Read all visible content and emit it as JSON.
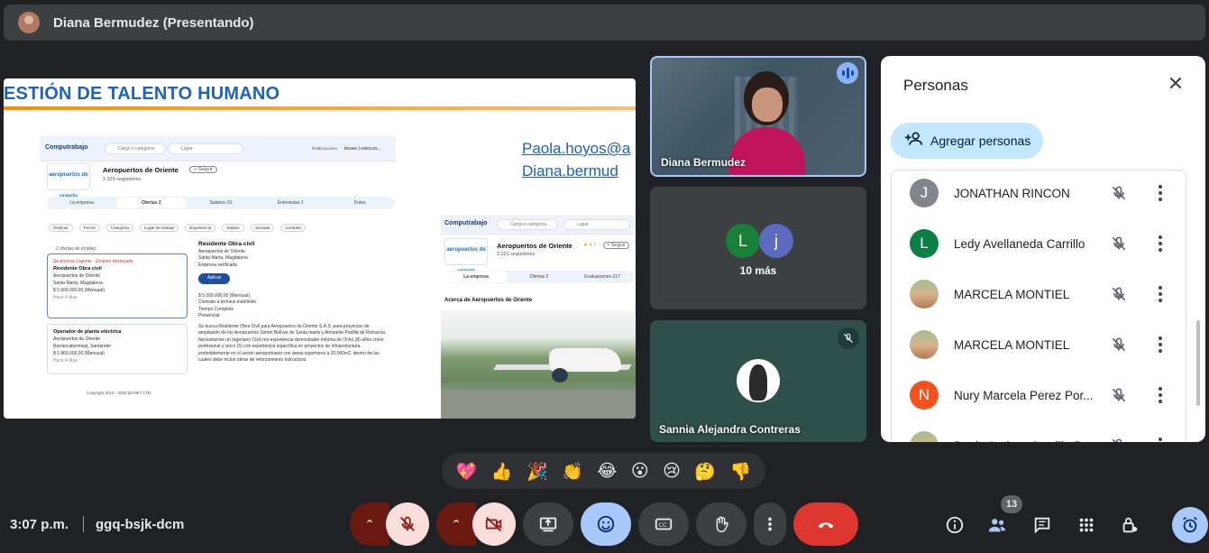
{
  "topbar": {
    "presenter": "Diana Bermudez (Presentando)"
  },
  "slide": {
    "heading": "ESTIÓN DE TALENTO HUMANO",
    "emails": [
      "Paola.hoyos@a",
      "Diana.bermud"
    ],
    "portal_logo": "Computrabajo",
    "search_job": "Cargo o categoría",
    "search_place": "Lugar",
    "notifications": "Notificaciones",
    "user": "DIANA CAROLIN...",
    "company": "Aeropuertos de Oriente",
    "followers1": "2.320 seguidores",
    "followers2": "2.321 seguidores",
    "rating": "★ 4.7",
    "follow": "+ Seguir",
    "logo_text": "aeropuertos de oriente",
    "tabs1": [
      "La empresa",
      "Ofertas 2",
      "Salarios 91",
      "Entrevistas 1",
      "Fotos"
    ],
    "tabs2": [
      "La empresa",
      "Ofertas 2",
      "Evaluaciones 217"
    ],
    "filters": [
      "Ordenar",
      "Fecha",
      "Categoría",
      "Lugar de trabajo",
      "Experiencia",
      "Salario",
      "Jornada",
      "Contrato"
    ],
    "offers_count": "2 ofertas de empleo",
    "card1": {
      "tag": "Se precisa Urgente · Empleo destacado",
      "title": "Residente Obra civil",
      "company": "Aeropuertos de Oriente",
      "place": "Santa Marta, Magdalena",
      "salary": "$ 5.000.000,00 (Mensual)",
      "ago": "Hace 4 días"
    },
    "card2": {
      "title": "Operador de planta eléctrica",
      "company": "Aeropuertos de Oriente",
      "place": "Barrancabermeja, Santander",
      "salary": "$ 1.860.000,00 (Mensual)",
      "ago": "Hace 4 días"
    },
    "detail": {
      "title": "Residente Obra civil",
      "company": "Aeropuertos de Oriente",
      "place": "Santa Marta, Magdalena",
      "verified": "Empresa verificada",
      "apply": "Aplicar",
      "salary": "$ 5.000.000,00 (Mensual)",
      "contract": "Contrato a término indefinido",
      "time": "Tiempo Completo",
      "mode": "Presencial",
      "desc": "Se busca Residente Obra Civil para Aeropuertos de Oriente S.A.S. para proyectos de ampliación de los Aeropuertos Simón Bolívar de Santa marta y Almirante Padilla de Riohacha. Necesitamos un Ingeniero Civil con experiencia demostrable mínima de Ocho (8) años como profesional y cinco (5) con experiencia específica en proyectos de infraestructura preferiblemente en el sector aeroportuario con áreas superiores a 20.000m2, dentro de las cuales debe incluir obras de reforzamiento estructural."
    },
    "copyright": "Copyright 2014 - 2025 DGNET LTD.",
    "about": "Acerca de Aeropuertos de Oriente"
  },
  "tiles": {
    "speaker_name": "Diana Bermudez",
    "others_avatars": [
      "L",
      "j"
    ],
    "others_colors": [
      "#188038",
      "#5c6bc0"
    ],
    "others_more": "10 más",
    "third_name": "Sannia Alejandra Contreras"
  },
  "panel": {
    "title": "Personas",
    "add_label": "Agregar personas",
    "people": [
      {
        "initial": "J",
        "name": "JONATHAN RINCON",
        "color": "#80868b"
      },
      {
        "initial": "L",
        "name": "Ledy Avellaneda Carrillo",
        "color": "#0b8043"
      },
      {
        "initial": "",
        "name": "MARCELA MONTIEL",
        "color": "photo"
      },
      {
        "initial": "",
        "name": "MARCELA MONTIEL",
        "color": "photo"
      },
      {
        "initial": "N",
        "name": "Nury Marcela Perez Por...",
        "color": "#f4511e"
      },
      {
        "initial": "",
        "name": "Paola Andrea Castillo R...",
        "color": "photo"
      }
    ]
  },
  "reactions": [
    "💖",
    "👍",
    "🎉",
    "👏",
    "😂",
    "😮",
    "😢",
    "🤔",
    "👎"
  ],
  "bottom": {
    "time": "3:07 p.m.",
    "meeting_code": "ggq-bsjk-dcm",
    "participants_count": "13"
  }
}
